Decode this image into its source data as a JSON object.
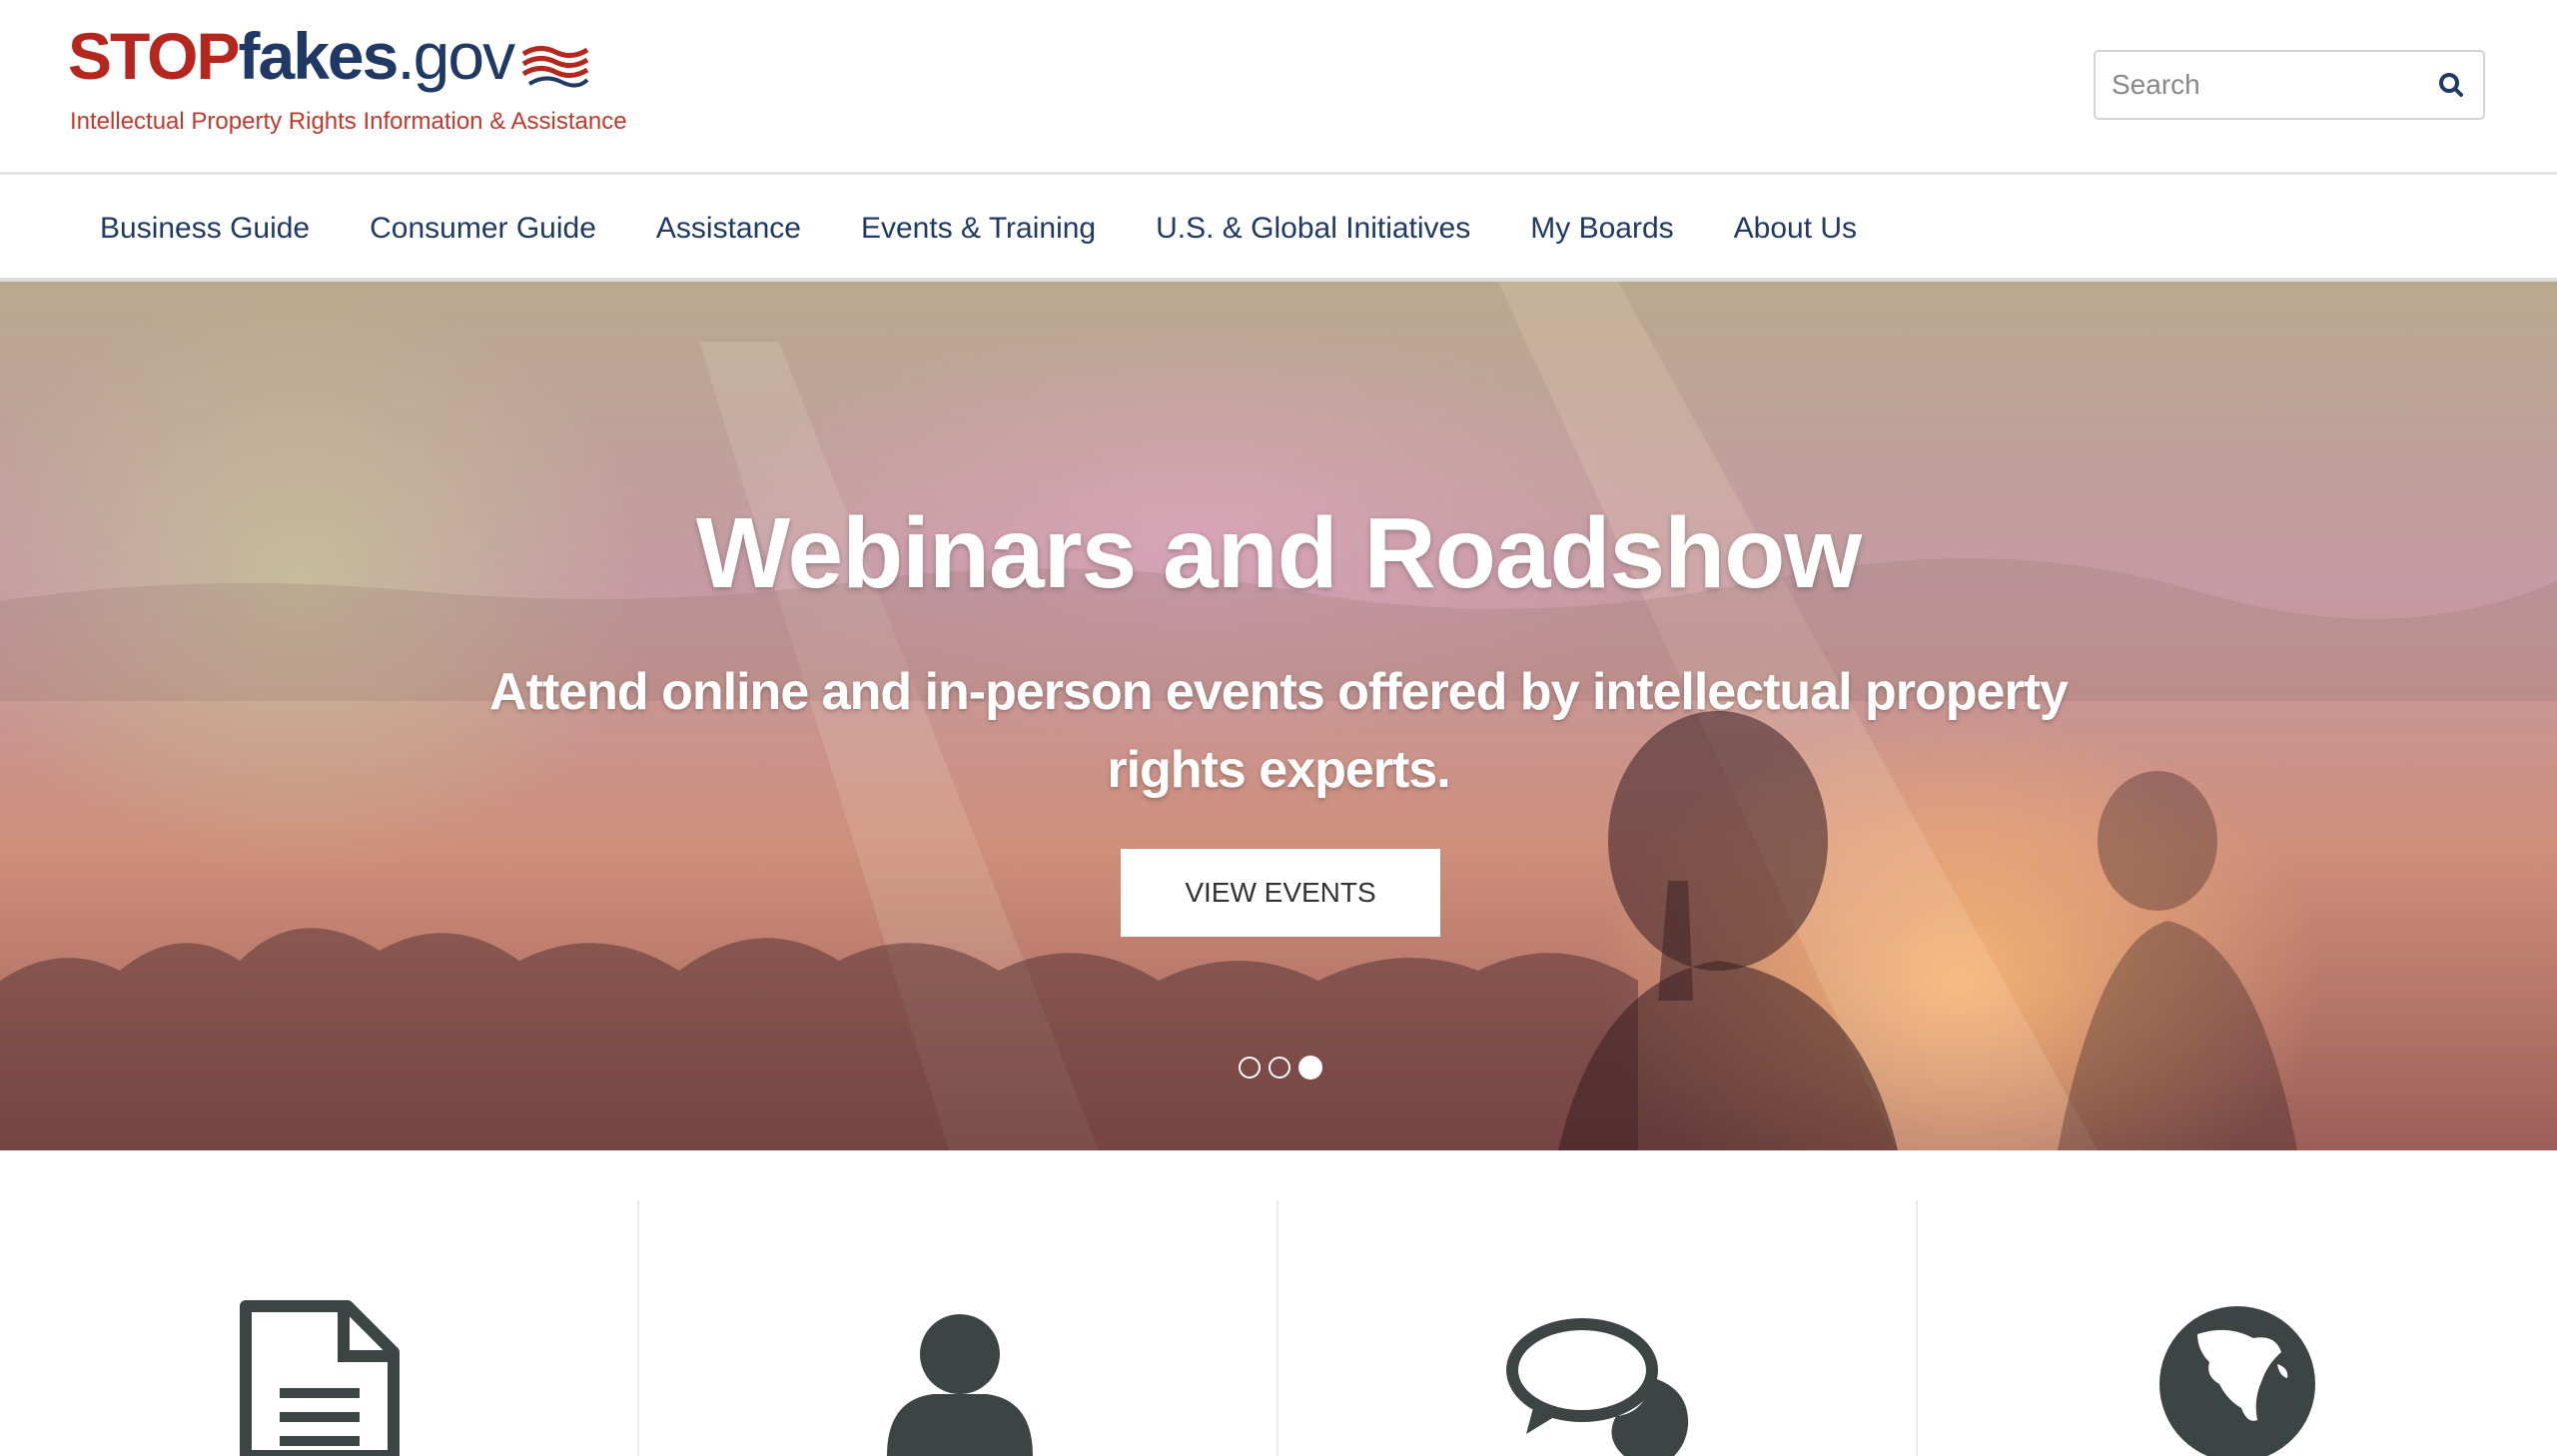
{
  "header": {
    "logo": {
      "stop": "STOP",
      "fakes": "fakes",
      "gov": ".gov",
      "tagline": "Intellectual Property Rights Information & Assistance"
    },
    "search": {
      "placeholder": "Search",
      "icon": "search-icon"
    }
  },
  "nav": {
    "items": [
      {
        "label": "Business Guide"
      },
      {
        "label": "Consumer Guide"
      },
      {
        "label": "Assistance"
      },
      {
        "label": "Events & Training"
      },
      {
        "label": "U.S. & Global Initiatives"
      },
      {
        "label": "My Boards"
      },
      {
        "label": "About Us"
      }
    ]
  },
  "hero": {
    "title": "Webinars and Roadshow",
    "subtitle": "Attend online and in-person events offered by intellectual property rights experts.",
    "button_label": "VIEW EVENTS",
    "slide_count": 3,
    "active_slide": 3
  },
  "features": {
    "icons": [
      "document-icon",
      "user-icon",
      "chat-bubbles-icon",
      "globe-icon"
    ],
    "icon_color": "#3d4444"
  },
  "colors": {
    "brand_red": "#b5271e",
    "brand_navy": "#1f3864",
    "tagline_red": "#c0392b"
  }
}
